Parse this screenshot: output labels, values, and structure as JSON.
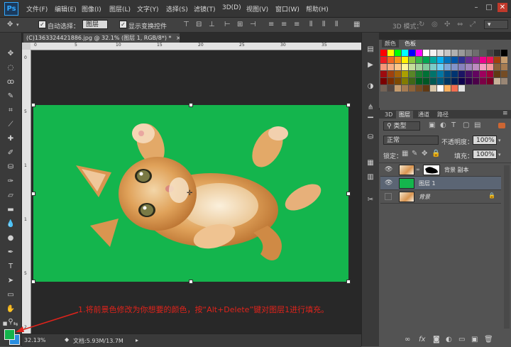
{
  "app": {
    "logo": "Ps"
  },
  "menu": [
    "文件(F)",
    "编辑(E)",
    "图像(I)",
    "图层(L)",
    "文字(Y)",
    "选择(S)",
    "滤镜(T)",
    "3D(D)",
    "视图(V)",
    "窗口(W)",
    "帮助(H)"
  ],
  "window_controls": {
    "minimize": "–",
    "maximize": "□",
    "close": "✕"
  },
  "options": {
    "auto_select_label": "自动选择：",
    "auto_select_value": "图层",
    "show_transform_label": "显示变换控件",
    "mode_3d_label": "3D 模式："
  },
  "document": {
    "tab_title": "(C)1363324421886.jpg @ 32.1% (图层 1, RGB/8*) *",
    "close": "×"
  },
  "ruler": {
    "top": [
      "0",
      "5",
      "10",
      "15",
      "20",
      "25",
      "30",
      "35"
    ],
    "left": [
      "0",
      "5",
      "1",
      "1",
      "5",
      "2"
    ]
  },
  "annotation": "1.将前景色修改为你想要的颜色，按“Alt+Delete”键对图层1进行填充。",
  "status": {
    "zoom": "32.13%",
    "doc_info": "文档:5.93M/13.7M"
  },
  "colors_panel": {
    "tabs": [
      "颜色",
      "色板"
    ],
    "swatches": [
      "#ff0000",
      "#ffff00",
      "#00ff00",
      "#00ffff",
      "#0000ff",
      "#ff00ff",
      "#ffffff",
      "#f2f2f2",
      "#dcdcdc",
      "#c6c6c6",
      "#b0b0b0",
      "#9a9a9a",
      "#848484",
      "#6e6e6e",
      "#585858",
      "#424242",
      "#2c2c2c",
      "#000000",
      "#ed1c24",
      "#f26522",
      "#f7941d",
      "#fff200",
      "#8dc63f",
      "#39b54a",
      "#00a651",
      "#00a99d",
      "#00aeef",
      "#0072bc",
      "#0054a6",
      "#2e3192",
      "#662d91",
      "#92278f",
      "#ec008c",
      "#ed145b",
      "#a0410d",
      "#c69c6d",
      "#f69679",
      "#f9ad81",
      "#fdc689",
      "#fff799",
      "#c4df9b",
      "#a3d39c",
      "#82ca9c",
      "#7accc8",
      "#6dcff6",
      "#7da7d9",
      "#8393ca",
      "#8781bd",
      "#a187be",
      "#bd8cbf",
      "#f49ac1",
      "#f5989d",
      "#8c6239",
      "#a67c52",
      "#9e0b0f",
      "#a0410d",
      "#a36209",
      "#aba000",
      "#598527",
      "#1a7b30",
      "#007236",
      "#00746b",
      "#0076a3",
      "#004b80",
      "#003471",
      "#1b1464",
      "#440e62",
      "#630460",
      "#9e005d",
      "#9e0039",
      "#603913",
      "#754c24",
      "#790000",
      "#7b2e00",
      "#7d4900",
      "#827b00",
      "#406618",
      "#005e20",
      "#005826",
      "#005952",
      "#005b7f",
      "#003663",
      "#002157",
      "#0d004c",
      "#32004b",
      "#4b0049",
      "#7b0046",
      "#7a0026",
      "#c7b299",
      "#998675",
      "#736357",
      "#534741",
      "#c69c6d",
      "#a67c52",
      "#8c6239",
      "#754c24",
      "#603913",
      "#d7c5a8",
      "#ffffff",
      "#fbaf5d",
      "#f26c4f",
      "#e0e0e0"
    ]
  },
  "layers_panel": {
    "tabs": [
      "3D",
      "图层",
      "通道",
      "路径"
    ],
    "filter": "类型",
    "blend_mode": "正常",
    "opacity_label": "不透明度：",
    "opacity_value": "100%",
    "lock_label": "锁定：",
    "fill_label": "填充：",
    "fill_value": "100%",
    "layers": [
      {
        "name": "背景 副本",
        "thumb": "cat",
        "selected": false
      },
      {
        "name": "图层 1",
        "thumb": "green",
        "selected": true
      },
      {
        "name": "背景",
        "thumb": "cat",
        "selected": false
      }
    ]
  }
}
